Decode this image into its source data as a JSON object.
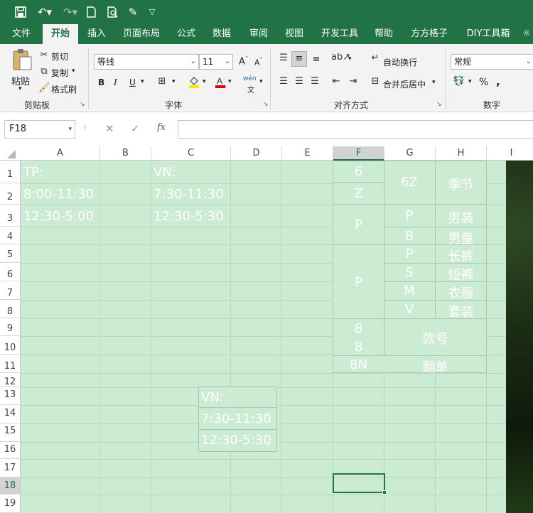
{
  "qat": {
    "save_icon": "save-icon",
    "undo_icon": "undo-icon",
    "redo_icon": "redo-icon",
    "new_icon": "new-file-icon",
    "preview_icon": "print-preview-icon",
    "customize_icon": "customize-icon"
  },
  "tabs": [
    "文件",
    "开始",
    "插入",
    "页面布局",
    "公式",
    "数据",
    "审阅",
    "视图",
    "开发工具",
    "帮助",
    "方方格子",
    "DIY工具箱"
  ],
  "active_tab": "开始",
  "ribbon": {
    "clipboard": {
      "paste": "粘贴",
      "cut": "剪切",
      "copy": "复制",
      "format_painter": "格式刷",
      "label": "剪贴板"
    },
    "font": {
      "name": "等线",
      "size": "11",
      "bold": "B",
      "italic": "I",
      "underline": "U",
      "grow": "A",
      "shrink": "A",
      "phonetic": "wén",
      "label": "字体"
    },
    "alignment": {
      "wrap": "自动换行",
      "merge": "合并后居中",
      "label": "对齐方式"
    },
    "number": {
      "format": "常规",
      "percent": "%",
      "comma": ",",
      "label": "数字"
    }
  },
  "formula_bar": {
    "name_box": "F18",
    "fx": "fx",
    "formula": ""
  },
  "columns": [
    "A",
    "B",
    "C",
    "D",
    "E",
    "F",
    "G",
    "H",
    "I"
  ],
  "selected_column": "F",
  "rows": [
    "1",
    "2",
    "3",
    "4",
    "5",
    "6",
    "7",
    "8",
    "9",
    "10",
    "11",
    "12",
    "13",
    "14",
    "15",
    "16",
    "17",
    "18",
    "19"
  ],
  "selected_row": "18",
  "cells": {
    "A1": "TP:",
    "A2": "8:00-11:30",
    "A3": "12:30-5:00",
    "C1": "VN:",
    "C2": "7:30-11:30",
    "C3": "12:30-5:30"
  },
  "code_table": {
    "f1": "6",
    "f2": "Z",
    "g12": "6Z",
    "h12": "季节",
    "f34": "P",
    "g3": "P",
    "h3": "男装",
    "g4": "B",
    "h4": "男童",
    "f58": "P",
    "g5": "P",
    "h5": "长裤",
    "g6": "S",
    "h6": "短裤",
    "g7": "M",
    "h7": "衣服",
    "g8": "V",
    "h8": "套装",
    "f9": "8",
    "f10": "8",
    "gh910": "款号",
    "f11": "8N",
    "gh11": "翻单"
  },
  "floating_box": [
    "VN:",
    "7:30-11:30",
    "12:30-5:30"
  ]
}
